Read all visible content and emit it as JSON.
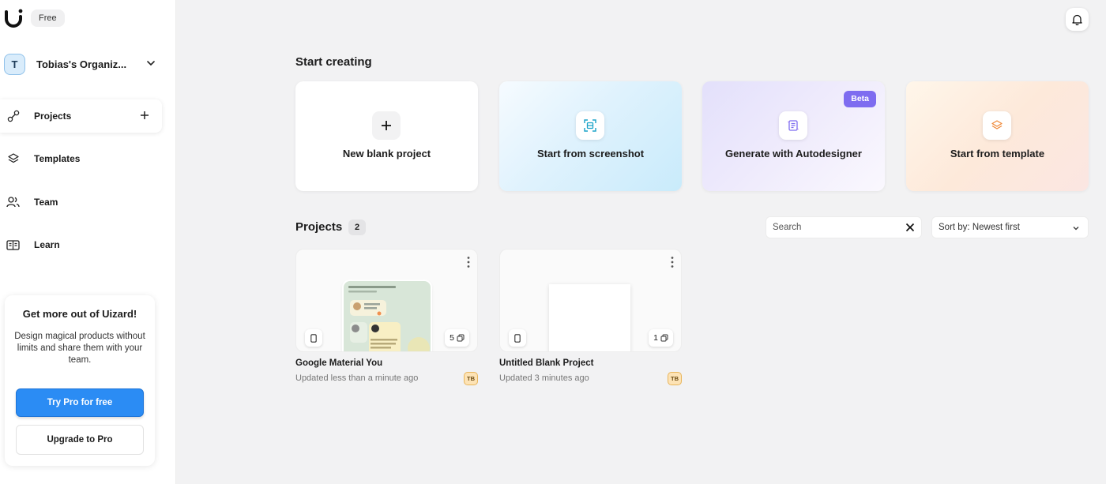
{
  "sidebar": {
    "plan_badge": "Free",
    "org": {
      "initial": "T",
      "name": "Tobias's Organiz..."
    },
    "nav": {
      "projects": "Projects",
      "templates": "Templates",
      "team": "Team",
      "learn": "Learn"
    },
    "promo": {
      "title": "Get more out of Uizard!",
      "text": "Design magical products without limits and share them with your team.",
      "try_pro": "Try Pro for free",
      "upgrade": "Upgrade to Pro"
    }
  },
  "start_creating": {
    "title": "Start creating",
    "cards": {
      "blank": "New blank project",
      "screenshot": "Start from screenshot",
      "autodesigner": "Generate with Autodesigner",
      "autodesigner_badge": "Beta",
      "template": "Start from template"
    }
  },
  "projects": {
    "title": "Projects",
    "count": "2",
    "search_placeholder": "Search",
    "sort_label": "Sort by: Newest first",
    "items": [
      {
        "name": "Google Material You",
        "updated": "Updated less than a minute ago",
        "screens": "5",
        "owner": "TB"
      },
      {
        "name": "Untitled Blank Project",
        "updated": "Updated 3 minutes ago",
        "screens": "1",
        "owner": "TB"
      }
    ]
  },
  "colors": {
    "primary": "#2b8cf4",
    "beta": "#7e6cf0",
    "background": "#f2f2f3"
  },
  "icons": {
    "logo": "uizard-logo",
    "bell": "bell-icon",
    "projects": "projects-icon",
    "templates": "layers-icon",
    "team": "team-icon",
    "learn": "book-icon"
  }
}
